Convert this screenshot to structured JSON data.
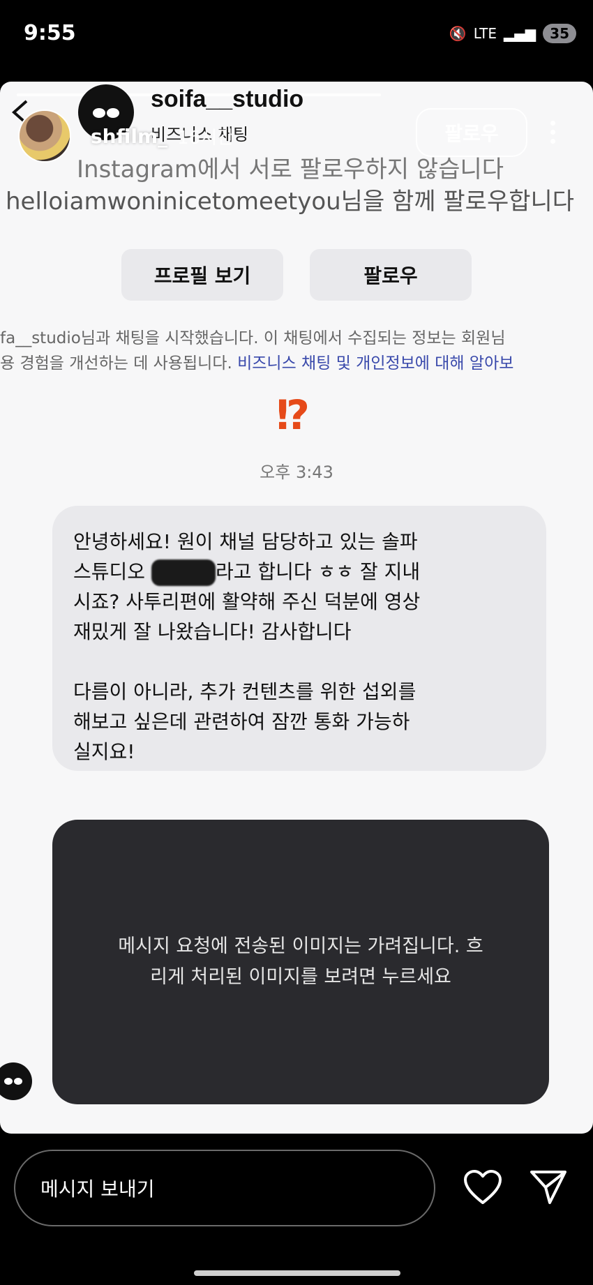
{
  "status_bar": {
    "time": "9:55",
    "network": "LTE",
    "battery": "35"
  },
  "story_overlay": {
    "username": "shfilm_",
    "time_ago": "16시간",
    "follow_label": "팔로우"
  },
  "chat_header": {
    "business_name": "soifa__studio",
    "subtitle": "비즈니스 채팅",
    "ghost_line1": "Instagram에서 서로 팔로우하지 않습니다",
    "ghost_line2": "helloiamwoninicetomeetyou님을 함께 팔로우합니다"
  },
  "actions": {
    "view_profile_label": "프로필 보기",
    "follow_label": "팔로우"
  },
  "info_text": {
    "line1": "fa__studio님과 채팅을 시작했습니다. 이 채팅에서 수집되는 정보는 회원님",
    "line2_prefix": "용 경험을 개선하는 데 사용됩니다. ",
    "link": "비즈니스 채팅 및 개인정보에 대해 알아보"
  },
  "sticker": "⁉",
  "message": {
    "timestamp": "오후 3:43",
    "line1": "안녕하세요! 원이 채널 담당하고 있는 솔파",
    "line2_prefix": "스튜디오 ",
    "line2_suffix": "라고 합니다 ㅎㅎ 잘 지내",
    "line3": "시죠? 사투리편에 활약해 주신 덕분에 영상",
    "line4": "재밌게 잘 나왔습니다! 감사합니다",
    "line5": "다름이 아니라, 추가 컨텐츠를 위한 섭외를",
    "line6": "해보고 싶은데 관련하여 잠깐 통화 가능하",
    "line7": "실지요!"
  },
  "blurred_image": {
    "line1": "메시지 요청에 전송된 이미지는 가려집니다. 흐",
    "line2": "리게 처리된 이미지를 보려면 누르세요"
  },
  "reply_bar": {
    "placeholder": "메시지 보내기"
  },
  "colors": {
    "link": "#3949ab",
    "sticker": "#e64a19",
    "bubble": "#e9e9ec",
    "blurred_bg": "#2a2a2e"
  }
}
